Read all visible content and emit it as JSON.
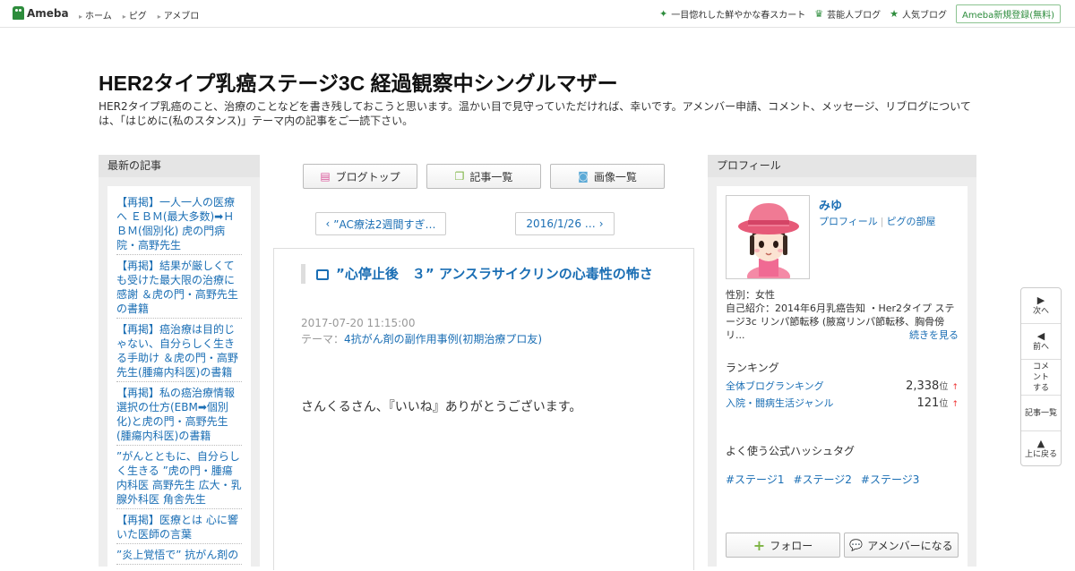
{
  "topbar": {
    "logo": "Ameba",
    "nav": [
      "ホーム",
      "ピグ",
      "アメブロ"
    ],
    "right": [
      {
        "icon": "star-icon",
        "label": "一目惚れした鮮やかな春スカート"
      },
      {
        "icon": "crown-icon",
        "label": "芸能人ブログ"
      },
      {
        "icon": "star-icon",
        "label": "人気ブログ"
      }
    ],
    "register": "Ameba新規登録(無料)"
  },
  "blog": {
    "title": "HER2タイプ乳癌ステージ3C 経過観察中シングルマザー",
    "description": "HER2タイプ乳癌のこと、治療のことなどを書き残しておこうと思います。温かい目で見守っていただければ、幸いです。アメンバー申請、コメント、メッセージ、リブログについては、「はじめに(私のスタンス)」テーマ内の記事をご一読下さい。"
  },
  "left_sidebar": {
    "heading": "最新の記事",
    "articles": [
      "【再掲】一人一人の医療へ ＥＢＭ(最大多数)➡ＨＢＭ(個別化) 虎の門病院・高野先生",
      "【再掲】結果が厳しくても受けた最大限の治療に感謝 ＆虎の門・高野先生の書籍",
      "【再掲】癌治療は目的じゃない、自分らしく生きる手助け ＆虎の門・高野先生(腫瘍内科医)の書籍",
      "【再掲】私の癌治療情報選択の仕方(EBM➡個別化)と虎の門・高野先生(腫瘍内科医)の書籍",
      "”がんとともに、自分らしく生きる ”虎の門・腫瘍内科医 高野先生 広大・乳腺外科医 角舎先生",
      "【再掲】医療とは 心に響いた医師の言葉",
      "”炎上覚悟で” 抗がん剤の"
    ]
  },
  "main": {
    "buttons": [
      {
        "icon": "document-icon",
        "label": "ブログトップ"
      },
      {
        "icon": "list-icon",
        "label": "記事一覧"
      },
      {
        "icon": "camera-icon",
        "label": "画像一覧"
      }
    ],
    "prev": "”AC療法2週間すぎ…",
    "next": "2016/1/26 …",
    "entry": {
      "title": "”心停止後　３” アンスラサイクリンの心毒性の怖さ",
      "date": "2017-07-20 11:15:00",
      "theme_label": "テーマ：",
      "theme": "4抗がん剤の副作用事例(初期治療プロ友)",
      "body": "さんくるさん、『いいね』ありがとうございます。"
    }
  },
  "right_sidebar": {
    "heading": "プロフィール",
    "name": "みゆ",
    "links": [
      "プロフィール",
      "ピグの部屋"
    ],
    "gender": "性別：女性",
    "intro": "自己紹介：2014年6月乳癌告知 ・Her2タイプ ステージ3c リンパ節転移 (腋窩リンパ節転移、胸骨傍リ...",
    "more": "続きを見る",
    "ranking_heading": "ランキング",
    "rankings": [
      {
        "label": "全体ブログランキング",
        "value": "2,338",
        "unit": "位",
        "trend": "↑"
      },
      {
        "label": "入院・闘病生活ジャンル",
        "value": "121",
        "unit": "位",
        "trend": "↑"
      }
    ],
    "hashtag_heading": "よく使う公式ハッシュタグ",
    "hashtags": [
      "#ステージ1",
      "#ステージ2",
      "#ステージ3"
    ],
    "follow": "フォロー",
    "amember": "アメンバーになる"
  },
  "floating_nav": [
    "次へ",
    "前へ",
    "コメントする",
    "記事一覧",
    "上に戻る"
  ],
  "colors": {
    "link": "#1a6eb4",
    "brand": "#2d8c3c",
    "trend_up": "#e33"
  }
}
